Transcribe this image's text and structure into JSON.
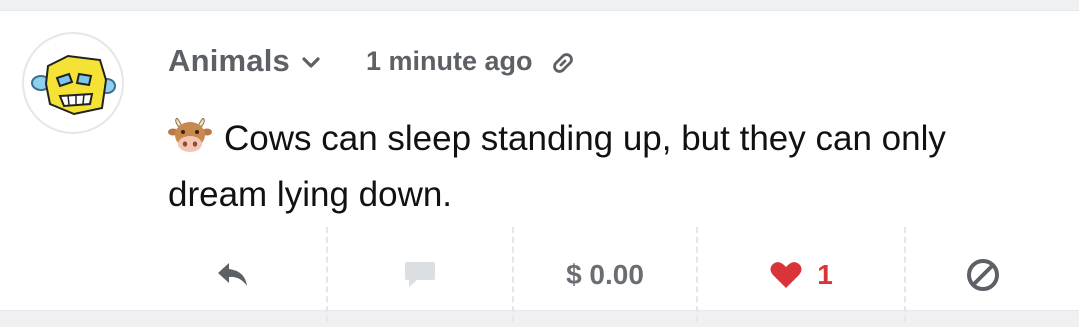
{
  "post": {
    "author": "Animals",
    "time": "1 minute ago",
    "text": "Cows can sleep standing up, but they can only dream lying down.",
    "emoji": "cow-face-icon"
  },
  "actions": {
    "tip": "$ 0.00",
    "like_count": "1"
  },
  "colors": {
    "like": "#d9343a",
    "muted": "#5d6166",
    "comment_disabled": "#dcdfe2",
    "avatar_yellow": "#f4e234"
  }
}
